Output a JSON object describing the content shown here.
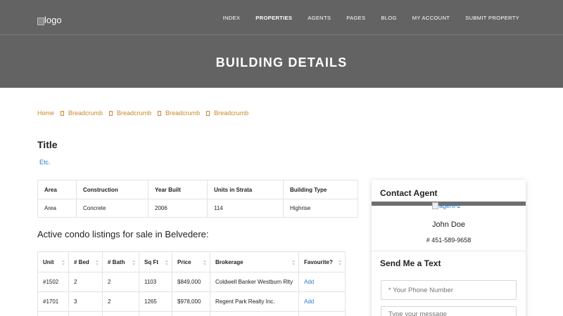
{
  "header": {
    "logo_alt": "logo",
    "title": "BUILDING DETAILS",
    "nav": [
      "INDEX",
      "PROPERTIES",
      "AGENTS",
      "PAGES",
      "BLOG",
      "MY ACCOUNT",
      "SUBMIT PROPERTY"
    ],
    "active_nav": "PROPERTIES"
  },
  "breadcrumb": [
    "Home",
    "Breadcrumb",
    "Breadcrumb",
    "Breadcrumb",
    "Breadcrumb"
  ],
  "content": {
    "title": "Title",
    "etc": "Etc."
  },
  "building_info": {
    "headers": [
      "Area",
      "Construction",
      "Year Built",
      "Units in Strata",
      "Building Type"
    ],
    "row": [
      "Area",
      "Concrete",
      "2006",
      "114",
      "Highrise"
    ]
  },
  "listings": {
    "title": "Active condo listings for sale in Belvedere:",
    "headers": [
      "Unit",
      "# Bed",
      "# Bath",
      "Sq Ft",
      "Price",
      "Brokerage",
      "Favourite?"
    ],
    "rows": [
      [
        "#1502",
        "2",
        "2",
        "1103",
        "$849,000",
        "Coldwell Banker Westburn Rlty",
        "Add"
      ],
      [
        "#1701",
        "3",
        "2",
        "1265",
        "$978,000",
        "Regent Park Realty Inc.",
        "Add"
      ]
    ]
  },
  "sidebar": {
    "contact_title": "Contact Agent",
    "agent_image_alt": "agent-2",
    "agent_name": "John Doe",
    "agent_phone": "# 451-589-9658",
    "text_title": "Send Me a Text",
    "phone_placeholder": "* Your Phone Number",
    "message_placeholder": "Type your message"
  },
  "colors": {
    "header_bg": "#636363",
    "link": "#2b7dc8",
    "breadcrumb": "#c7882e"
  }
}
